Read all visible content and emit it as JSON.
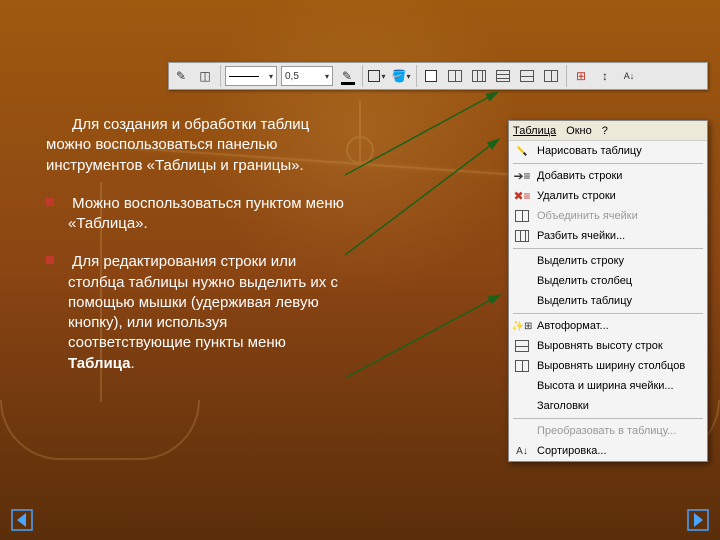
{
  "toolbar": {
    "line_weight_value": "0,5",
    "items": [
      "draw-table",
      "eraser",
      "sep",
      "line-style",
      "line-weight",
      "border-color",
      "sep",
      "outside-border",
      "fill-color",
      "sep",
      "insert-table",
      "merge-cells",
      "split-cells",
      "align",
      "distribute-rows",
      "distribute-cols",
      "sep",
      "table-autoformat",
      "change-direction",
      "sort"
    ]
  },
  "content": {
    "p1": "Для создания и обработки таблиц можно воспользоваться панелью инструментов «Таблицы и границы».",
    "p2": "Можно воспользоваться пунктом меню «Таблица».",
    "p3_prefix": "Для редактирования строки или столбца таблицы нужно выделить их с помощью мышки (удерживая левую кнопку), или используя соответствующие пункты меню ",
    "p3_bold": "Таблица",
    "p3_suffix": "."
  },
  "menu": {
    "bar": {
      "table": "Таблица",
      "window": "Окно",
      "help": "?"
    },
    "items": [
      {
        "label": "Нарисовать таблицу",
        "icon": "pencil",
        "disabled": false
      },
      {
        "sep": true
      },
      {
        "label": "Добавить строки",
        "icon": "ins-row",
        "disabled": false
      },
      {
        "label": "Удалить строки",
        "icon": "del-row",
        "disabled": false
      },
      {
        "label": "Объединить ячейки",
        "icon": "merge",
        "disabled": true
      },
      {
        "label": "Разбить ячейки...",
        "icon": "split",
        "disabled": false
      },
      {
        "sep": true
      },
      {
        "label": "Выделить строку",
        "icon": "",
        "disabled": false
      },
      {
        "label": "Выделить столбец",
        "icon": "",
        "disabled": false
      },
      {
        "label": "Выделить таблицу",
        "icon": "",
        "disabled": false
      },
      {
        "sep": true
      },
      {
        "label": "Автоформат...",
        "icon": "af",
        "disabled": false
      },
      {
        "label": "Выровнять высоту строк",
        "icon": "rows-h",
        "disabled": false
      },
      {
        "label": "Выровнять ширину столбцов",
        "icon": "rows-w",
        "disabled": false
      },
      {
        "label": "Высота и ширина ячейки...",
        "icon": "",
        "disabled": false
      },
      {
        "label": "Заголовки",
        "icon": "",
        "disabled": false
      },
      {
        "sep": true
      },
      {
        "label": "Преобразовать в таблицу...",
        "icon": "",
        "disabled": true
      },
      {
        "label": "Сортировка...",
        "icon": "sort",
        "disabled": false
      }
    ]
  },
  "nav": {
    "prev": "prev-slide",
    "next": "next-slide"
  }
}
